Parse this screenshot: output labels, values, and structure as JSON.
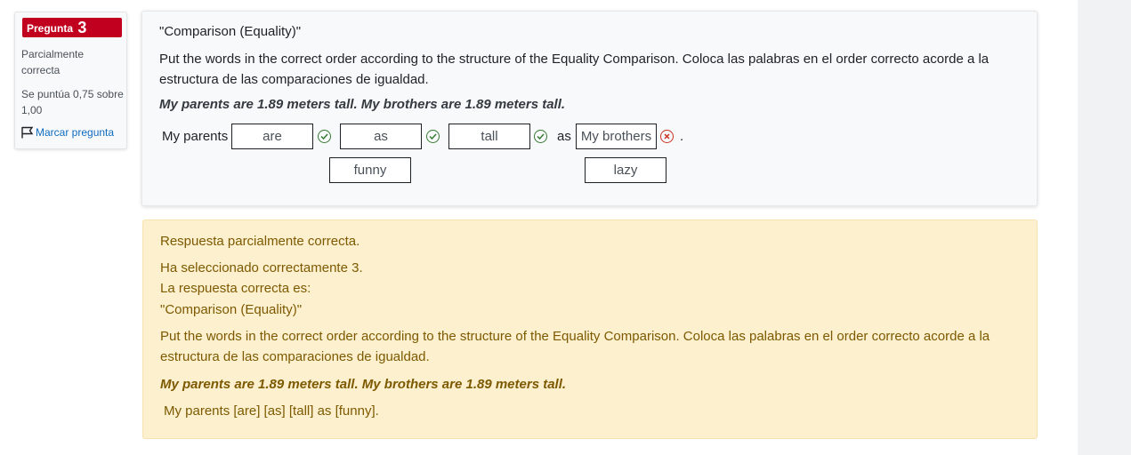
{
  "info": {
    "question_label": "Pregunta",
    "question_number": "3",
    "state_line1": "Parcialmente",
    "state_line2": "correcta",
    "grade_line1": "Se puntúa 0,75 sobre",
    "grade_line2": "1,00",
    "flag_label": "Marcar pregunta"
  },
  "question": {
    "title": "\"Comparison (Equality)\"",
    "text": "Put the words in the correct order according to the structure of the Equality Comparison. Coloca las palabras en el order correcto acorde a la estructura de las comparaciones de igualdad.",
    "example": "My parents are 1.89 meters tall. My brothers are 1.89 meters tall.",
    "lead": "My parents",
    "drops": [
      "are",
      "as",
      "tall",
      "My brothers"
    ],
    "connector": "as",
    "end": ".",
    "choices": [
      "funny",
      "lazy"
    ]
  },
  "feedback": {
    "partial": "Respuesta parcialmente correcta.",
    "selected": "Ha seleccionado correctamente 3.",
    "correct_is": "La respuesta correcta es:",
    "title": "\"Comparison (Equality)\"",
    "text": "Put the words in the correct order according to the structure of the Equality Comparison. Coloca las palabras en el order correcto acorde a la estructura de las comparaciones de igualdad.",
    "example": "My parents are 1.89 meters tall. My brothers are 1.89 meters tall.",
    "answer": "My parents [are] [as] [tall] as [funny]."
  },
  "colors": {
    "badge": "#c1001f",
    "correct": "#357a32",
    "incorrect": "#ca3120",
    "feedback_bg": "#fdf0cf",
    "link": "#0f6cbf"
  }
}
